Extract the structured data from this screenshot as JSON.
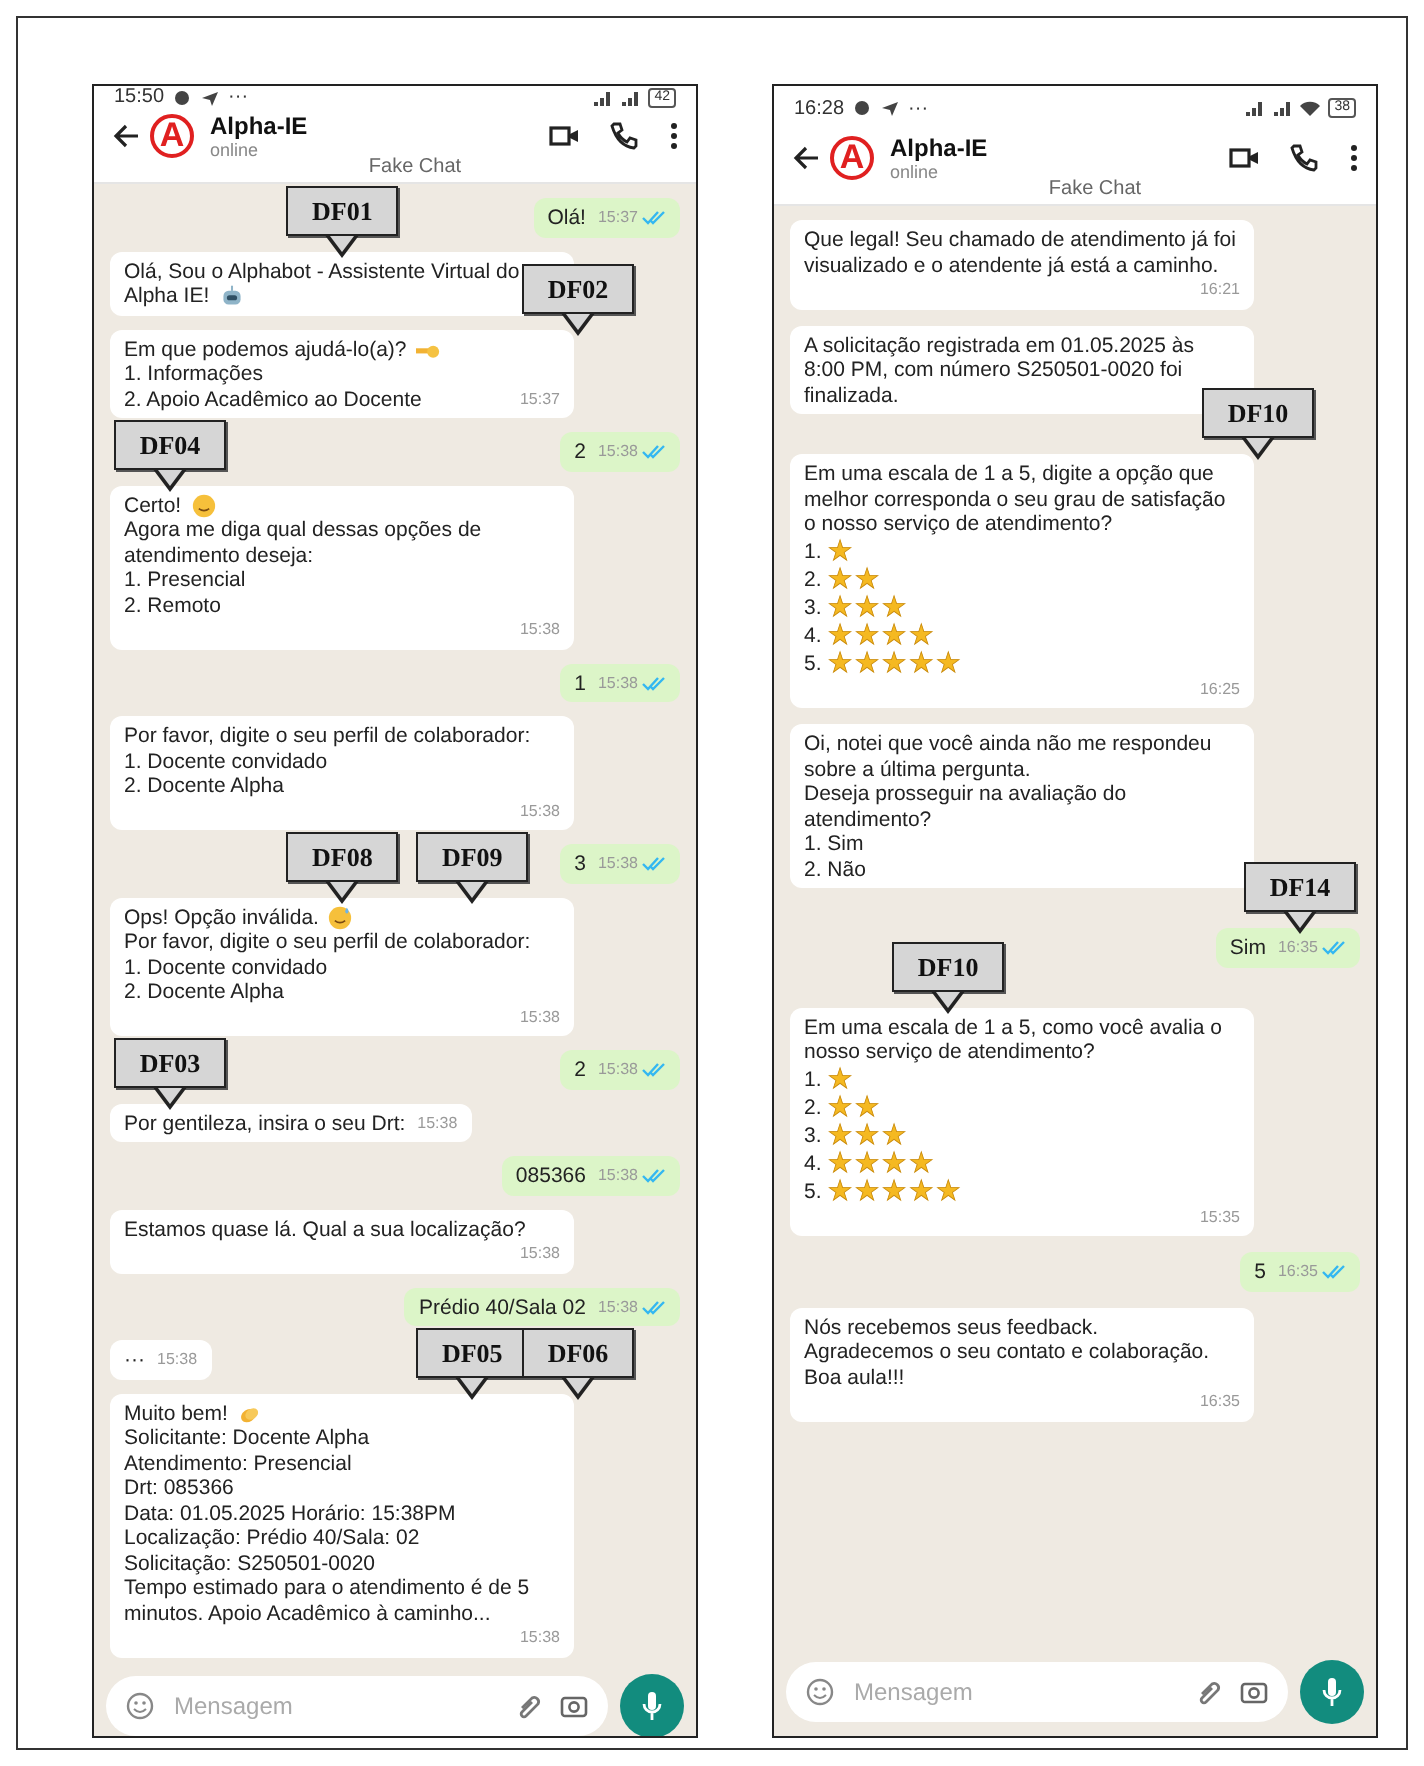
{
  "phones": [
    {
      "status_bar": {
        "time": "15:50",
        "more": "···",
        "battery": "42",
        "wifi": false
      },
      "header": {
        "avatar_letter": "A",
        "name": "Alpha-IE",
        "status": "online",
        "chat_label": "Fake Chat"
      },
      "messages": [
        {
          "kind": "outgoing",
          "lines": [
            {
              "kind": "text",
              "text": "Olá!"
            }
          ],
          "time": "15:37",
          "read": true
        },
        {
          "kind": "incoming",
          "lines": [
            {
              "kind": "text",
              "text": "Olá, Sou o Alphabot - Assistente Virtual do"
            },
            {
              "kind": "robot",
              "text": "Alpha IE!"
            }
          ],
          "callouts": [
            {
              "kind": "middle",
              "label": "DF01"
            }
          ]
        },
        {
          "kind": "incoming",
          "lines": [
            {
              "kind": "hand",
              "text": "Em que podemos ajudá-lo(a)?"
            },
            {
              "kind": "text",
              "text": "1. Informações"
            },
            {
              "kind": "text",
              "text": "2. Apoio Acadêmico ao Docente"
            }
          ],
          "time": "15:37",
          "callouts": [
            {
              "kind": "edge",
              "label": "DF02"
            }
          ]
        },
        {
          "kind": "outgoing",
          "lines": [
            {
              "kind": "text",
              "text": "2"
            }
          ],
          "time": "15:38",
          "read": true
        },
        {
          "kind": "incoming",
          "lines": [
            {
              "kind": "smile",
              "text": "Certo!"
            },
            {
              "kind": "text",
              "text": "Agora me diga qual dessas opções de atendimento deseja:"
            },
            {
              "kind": "text",
              "text": "1. Presencial"
            },
            {
              "kind": "text",
              "text": "2. Remoto"
            }
          ],
          "time": "15:38",
          "callouts": [
            {
              "kind": "left",
              "label": "DF04"
            }
          ]
        },
        {
          "kind": "outgoing",
          "lines": [
            {
              "kind": "text",
              "text": "1"
            }
          ],
          "time": "15:38",
          "read": true
        },
        {
          "kind": "incoming",
          "lines": [
            {
              "kind": "text",
              "text": "Por favor, digite o seu perfil de colaborador:"
            },
            {
              "kind": "text",
              "text": "1. Docente convidado"
            },
            {
              "kind": "text",
              "text": "2. Docente Alpha"
            }
          ],
          "time": "15:38"
        },
        {
          "kind": "outgoing",
          "lines": [
            {
              "kind": "text",
              "text": "3"
            }
          ],
          "time": "15:38",
          "read": true
        },
        {
          "kind": "incoming",
          "lines": [
            {
              "kind": "sweat",
              "text": "Ops! Opção inválida."
            },
            {
              "kind": "text",
              "text": "Por favor, digite o seu perfil de colaborador:"
            },
            {
              "kind": "text",
              "text": "1. Docente convidado"
            },
            {
              "kind": "text",
              "text": "2. Docente Alpha"
            }
          ],
          "time": "15:38",
          "callouts": [
            {
              "kind": "middle",
              "label": "DF08"
            },
            {
              "kind": "right",
              "label": "DF09"
            }
          ]
        },
        {
          "kind": "outgoing",
          "lines": [
            {
              "kind": "text",
              "text": "2"
            }
          ],
          "time": "15:38",
          "read": true
        },
        {
          "kind": "incoming",
          "lines": [
            {
              "kind": "text",
              "text": "Por gentileza, insira o seu Drt:"
            }
          ],
          "time": "15:38",
          "callouts": [
            {
              "kind": "left",
              "label": "DF03"
            }
          ]
        },
        {
          "kind": "outgoing",
          "lines": [
            {
              "kind": "text",
              "text": "085366"
            }
          ],
          "time": "15:38",
          "read": true
        },
        {
          "kind": "incoming",
          "lines": [
            {
              "kind": "text",
              "text": "Estamos quase lá. Qual a sua localização?"
            }
          ],
          "time": "15:38"
        },
        {
          "kind": "outgoing",
          "lines": [
            {
              "kind": "text",
              "text": "Prédio 40/Sala 02"
            }
          ],
          "time": "15:38",
          "read": true
        },
        {
          "kind": "incoming",
          "lines": [
            {
              "kind": "text",
              "text": "···"
            }
          ],
          "time": "15:38"
        },
        {
          "kind": "incoming",
          "lines": [
            {
              "kind": "clap",
              "text": "Muito bem!"
            },
            {
              "kind": "text",
              "text": "Solicitante: Docente Alpha"
            },
            {
              "kind": "text",
              "text": "Atendimento: Presencial"
            },
            {
              "kind": "text",
              "text": "Drt: 085366"
            },
            {
              "kind": "text",
              "text": "Data: 01.05.2025 Horário: 15:38PM"
            },
            {
              "kind": "text",
              "text": "Localização: Prédio 40/Sala: 02"
            },
            {
              "kind": "text",
              "text": "Solicitação: S250501-0020"
            },
            {
              "kind": "text",
              "text": "Tempo estimado para o  atendimento é de 5 minutos. Apoio Acadêmico à caminho..."
            }
          ],
          "time": "15:38",
          "callouts": [
            {
              "kind": "right",
              "label": "DF05"
            },
            {
              "kind": "edge",
              "label": "DF06"
            }
          ]
        }
      ],
      "input": {
        "placeholder": "Mensagem"
      }
    },
    {
      "status_bar": {
        "time": "16:28",
        "more": "···",
        "battery": "38",
        "wifi": true
      },
      "header": {
        "avatar_letter": "A",
        "name": "Alpha-IE",
        "status": "online",
        "chat_label": "Fake Chat"
      },
      "messages": [
        {
          "kind": "incoming",
          "lines": [
            {
              "kind": "text",
              "text": "Que legal! Seu chamado de atendimento já foi visualizado e o atendente já está a caminho."
            }
          ],
          "time": "16:21"
        },
        {
          "kind": "incoming",
          "lines": [
            {
              "kind": "text",
              "text": "A solicitação registrada em 01.05.2025 às 8:00 PM, com número S250501-0020 foi finalizada."
            }
          ]
        },
        {
          "kind": "incoming",
          "lines": [
            {
              "kind": "text",
              "text": "Em uma escala de 1 a 5, digite a opção que melhor corresponda o seu grau de satisfação o nosso serviço de atendimento?"
            },
            {
              "kind": "rating",
              "text": "1.",
              "symbols": "★"
            },
            {
              "kind": "rating",
              "text": "2.",
              "symbols": "★★"
            },
            {
              "kind": "rating",
              "text": "3.",
              "symbols": "★★★"
            },
            {
              "kind": "rating",
              "text": "4.",
              "symbols": "★★★★"
            },
            {
              "kind": "rating",
              "text": "5.",
              "symbols": "★★★★★"
            }
          ],
          "time": "16:25",
          "callouts": [
            {
              "kind": "edge",
              "label": "DF10"
            }
          ]
        },
        {
          "kind": "incoming",
          "lines": [
            {
              "kind": "text",
              "text": "Oi, notei que você ainda não me respondeu sobre a última pergunta."
            },
            {
              "kind": "text",
              "text": "Deseja prosseguir na avaliação do atendimento?"
            },
            {
              "kind": "text",
              "text": "1. Sim"
            },
            {
              "kind": "text",
              "text": "2. Não"
            }
          ]
        },
        {
          "kind": "outgoing",
          "lines": [
            {
              "kind": "text",
              "text": "Sim"
            }
          ],
          "time": "16:35",
          "read": true,
          "callouts": [
            {
              "kind": "end",
              "label": "DF14"
            }
          ]
        },
        {
          "kind": "incoming",
          "lines": [
            {
              "kind": "text",
              "text": "Em uma escala de 1 a 5, como você avalia o nosso serviço de atendimento?"
            },
            {
              "kind": "rating",
              "text": "1.",
              "symbols": "★"
            },
            {
              "kind": "rating",
              "text": "2.",
              "symbols": "★★"
            },
            {
              "kind": "rating",
              "text": "3.",
              "symbols": "★★★"
            },
            {
              "kind": "rating",
              "text": "4.",
              "symbols": "★★★★"
            },
            {
              "kind": "rating",
              "text": "5.",
              "symbols": "★★★★★"
            }
          ],
          "time": "15:35",
          "callouts": [
            {
              "kind": "inner",
              "label": "DF10"
            }
          ]
        },
        {
          "kind": "outgoing",
          "lines": [
            {
              "kind": "text",
              "text": "5"
            }
          ],
          "time": "16:35",
          "read": true
        },
        {
          "kind": "incoming",
          "lines": [
            {
              "kind": "text",
              "text": "Nós recebemos seus feedback."
            },
            {
              "kind": "text",
              "text": "Agradecemos o seu contato e colaboração."
            },
            {
              "kind": "text",
              "text": "Boa aula!!!"
            }
          ],
          "time": "16:35"
        }
      ],
      "input": {
        "placeholder": "Mensagem"
      }
    }
  ]
}
